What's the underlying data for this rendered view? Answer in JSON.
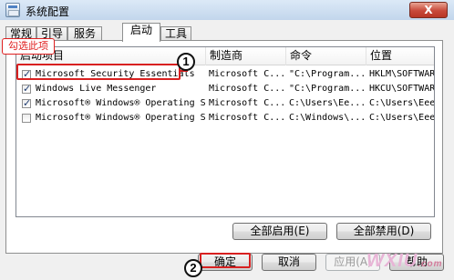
{
  "window": {
    "title": "系统配置",
    "close_symbol": "X"
  },
  "tabs": [
    {
      "label": "常规",
      "active": false
    },
    {
      "label": "引导",
      "active": false
    },
    {
      "label": "服务",
      "active": false
    },
    {
      "label": "启动",
      "active": true
    },
    {
      "label": "工具",
      "active": false
    }
  ],
  "list": {
    "columns": [
      "启动项目",
      "制造商",
      "命令",
      "位置"
    ],
    "rows": [
      {
        "checked": true,
        "item": "Microsoft Security Essentials",
        "maker": "Microsoft C...",
        "command": "\"C:\\Program...",
        "location": "HKLM\\SOFTWARE\\M"
      },
      {
        "checked": true,
        "item": "Windows Live Messenger",
        "maker": "Microsoft C...",
        "command": "\"C:\\Program...",
        "location": "HKCU\\SOFTWARE\\M"
      },
      {
        "checked": true,
        "item": "Microsoft® Windows® Operating Sy...",
        "maker": "Microsoft C...",
        "command": "C:\\Users\\Ee...",
        "location": "C:\\Users\\EeeKB\\"
      },
      {
        "checked": false,
        "item": "Microsoft® Windows® Operating Sy...",
        "maker": "Microsoft C...",
        "command": "C:\\Windows\\...",
        "location": "C:\\Users\\EeeKB\\"
      }
    ]
  },
  "panel_buttons": {
    "enable_all": "全部启用(E)",
    "disable_all": "全部禁用(D)"
  },
  "dialog_buttons": {
    "ok": "确定",
    "cancel": "取消",
    "apply": "应用(A)",
    "help": "帮助"
  },
  "annotations": {
    "callout_label": "勾选此项",
    "step1": "1",
    "step2": "2",
    "highlight_color": "#d82020"
  },
  "watermark": {
    "text": "WXIU",
    "suffix": ".com"
  }
}
